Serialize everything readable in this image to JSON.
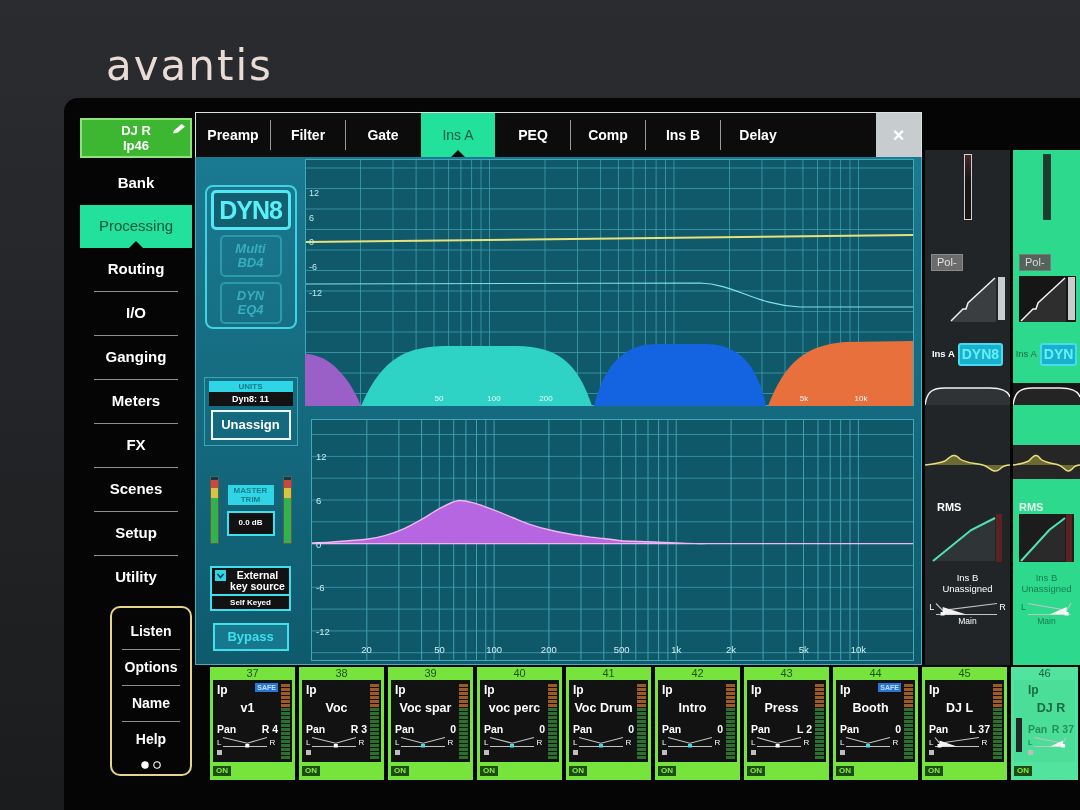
{
  "bezel": {
    "logo": "avantis"
  },
  "channel_header": {
    "name": "DJ R",
    "source": "Ip46"
  },
  "nav": [
    {
      "label": "Bank",
      "selected": false
    },
    {
      "label": "Processing",
      "selected": true
    },
    {
      "label": "Routing",
      "selected": false
    },
    {
      "label": "I/O",
      "selected": false
    },
    {
      "label": "Ganging",
      "selected": false
    },
    {
      "label": "Meters",
      "selected": false
    },
    {
      "label": "FX",
      "selected": false
    },
    {
      "label": "Scenes",
      "selected": false
    },
    {
      "label": "Setup",
      "selected": false
    },
    {
      "label": "Utility",
      "selected": false
    }
  ],
  "footer_menu": {
    "items": [
      {
        "label": "Listen"
      },
      {
        "label": "Options"
      },
      {
        "label": "Name"
      },
      {
        "label": "Help"
      }
    ],
    "pages": [
      {
        "selected": true
      },
      {
        "selected": false
      }
    ]
  },
  "tabs": [
    {
      "label": "Preamp",
      "selected": false
    },
    {
      "label": "Filter",
      "selected": false
    },
    {
      "label": "Gate",
      "selected": false
    },
    {
      "label": "Ins A",
      "selected": true
    },
    {
      "label": "PEQ",
      "selected": false
    },
    {
      "label": "Comp",
      "selected": false
    },
    {
      "label": "Ins B",
      "selected": false
    },
    {
      "label": "Delay",
      "selected": false
    }
  ],
  "close_button": "×",
  "unit_types": [
    {
      "label": "DYN8",
      "selected": true
    },
    {
      "label": "Multi BD4",
      "selected": false
    },
    {
      "label": "DYN EQ4",
      "selected": false
    }
  ],
  "units": {
    "title": "UNITS",
    "value": "Dyn8: 11"
  },
  "unassign_button": "Unassign",
  "master_trim": {
    "title": "MASTER TRIM",
    "value": "0.0 dB",
    "meters": [
      {
        "level": 0.95
      },
      {
        "level": 0.95
      }
    ]
  },
  "external_key": {
    "label": "External key source",
    "checked": true,
    "source": "Self Keyed"
  },
  "bypass_button": {
    "label": "Bypass",
    "on": false
  },
  "band_graph": {
    "y_labels": [
      "12",
      "6",
      "0",
      "-6",
      "-12"
    ],
    "x_labels": [
      "50",
      "100",
      "200",
      "5k",
      "10k"
    ],
    "bands": [
      {
        "color": "#9b5fc8"
      },
      {
        "color": "#2fd3c6"
      },
      {
        "color": "#1463e0"
      },
      {
        "color": "#e8703c"
      }
    ]
  },
  "eq_graph": {
    "chart_data": {
      "type": "area",
      "categories": [
        null,
        null,
        null,
        "20",
        null,
        null,
        null,
        "50",
        null,
        null,
        "100",
        null,
        null,
        "200",
        null,
        null,
        null,
        "500",
        null,
        null,
        "1k",
        null,
        null,
        "2k",
        null,
        null,
        null,
        "5k",
        null,
        null,
        "10k",
        null,
        null,
        null
      ],
      "series": [
        {
          "color": "#b566e0",
          "values": [
            0.1,
            0.2,
            0.4,
            0.6,
            1.1,
            2.0,
            3.3,
            4.8,
            5.9,
            5.5,
            4.6,
            3.6,
            2.6,
            1.9,
            1.4,
            1.0,
            0.7,
            0.4,
            0.3,
            0.2,
            0.1,
            0,
            0,
            0,
            0,
            0,
            0,
            0,
            0,
            0,
            0,
            0,
            0,
            0
          ]
        }
      ],
      "ylim": [
        -16,
        17
      ],
      "yticks": [
        12,
        6,
        0,
        -6,
        -12
      ],
      "grid": true
    }
  },
  "side_strips": [
    {
      "selected": false,
      "polarity": "Pol-",
      "insert_a": {
        "label": "Ins A",
        "unit": "DYN8"
      },
      "detector": "RMS",
      "insert_b": {
        "label": "Ins B",
        "status": "Unassigned"
      },
      "pan": {
        "left": "L",
        "right": "R",
        "bus": "Main",
        "level": 0.12
      }
    },
    {
      "selected": true,
      "polarity": "Pol-",
      "insert_a": {
        "label": "Ins A",
        "unit": "DYN"
      },
      "detector": "RMS",
      "insert_b": {
        "label": "Ins B",
        "status": "Unassigned"
      },
      "pan": {
        "left": "L",
        "bus": "Main",
        "level": 0.88
      }
    }
  ],
  "channels": [
    {
      "number": "37",
      "source": "Ip",
      "name": "v1",
      "badge": "SAFE",
      "pan": {
        "label": "Pan",
        "reading": "R 4",
        "left": "L",
        "right": "R",
        "level": 0.55
      },
      "on_button": {
        "label": "ON",
        "on": true
      },
      "selected": false
    },
    {
      "number": "38",
      "source": "Ip",
      "name": "Voc",
      "pan": {
        "label": "Pan",
        "reading": "R 3",
        "left": "L",
        "right": "R",
        "level": 0.54
      },
      "on_button": {
        "label": "ON",
        "on": true
      },
      "selected": false
    },
    {
      "number": "39",
      "source": "Ip",
      "name": "Voc spar",
      "pan": {
        "label": "Pan",
        "reading": "0",
        "left": "L",
        "right": "R",
        "level": 0.5
      },
      "on_button": {
        "label": "ON",
        "on": true
      },
      "selected": false
    },
    {
      "number": "40",
      "source": "Ip",
      "name": "voc perc",
      "pan": {
        "label": "Pan",
        "reading": "0",
        "left": "L",
        "right": "R",
        "level": 0.5
      },
      "on_button": {
        "label": "ON",
        "on": true
      },
      "selected": false
    },
    {
      "number": "41",
      "source": "Ip",
      "name": "Voc Drum",
      "pan": {
        "label": "Pan",
        "reading": "0",
        "left": "L",
        "right": "R",
        "level": 0.5
      },
      "on_button": {
        "label": "ON",
        "on": true
      },
      "selected": false
    },
    {
      "number": "42",
      "source": "Ip",
      "name": "Intro",
      "pan": {
        "label": "Pan",
        "reading": "0",
        "left": "L",
        "right": "R",
        "level": 0.5
      },
      "on_button": {
        "label": "ON",
        "on": true
      },
      "selected": false
    },
    {
      "number": "43",
      "source": "Ip",
      "name": "Press",
      "pan": {
        "label": "Pan",
        "reading": "L 2",
        "left": "L",
        "right": "R",
        "level": 0.47
      },
      "on_button": {
        "label": "ON",
        "on": true
      },
      "selected": false
    },
    {
      "number": "44",
      "source": "Ip",
      "name": "Booth",
      "badge": "SAFE",
      "pan": {
        "label": "Pan",
        "reading": "0",
        "left": "L",
        "right": "R",
        "level": 0.5
      },
      "on_button": {
        "label": "ON",
        "on": true
      },
      "selected": false
    },
    {
      "number": "45",
      "source": "Ip",
      "name": "DJ L",
      "pan": {
        "label": "Pan",
        "reading": "L 37",
        "left": "L",
        "right": "R",
        "level": 0.12
      },
      "on_button": {
        "label": "ON",
        "on": true
      },
      "selected": false
    },
    {
      "number": "46",
      "source": "Ip",
      "name": "DJ R",
      "pan": {
        "label": "Pan",
        "reading": "R 37",
        "left": "L",
        "level": 0.88
      },
      "on_button": {
        "label": "ON",
        "on": true
      },
      "selected": true
    }
  ]
}
